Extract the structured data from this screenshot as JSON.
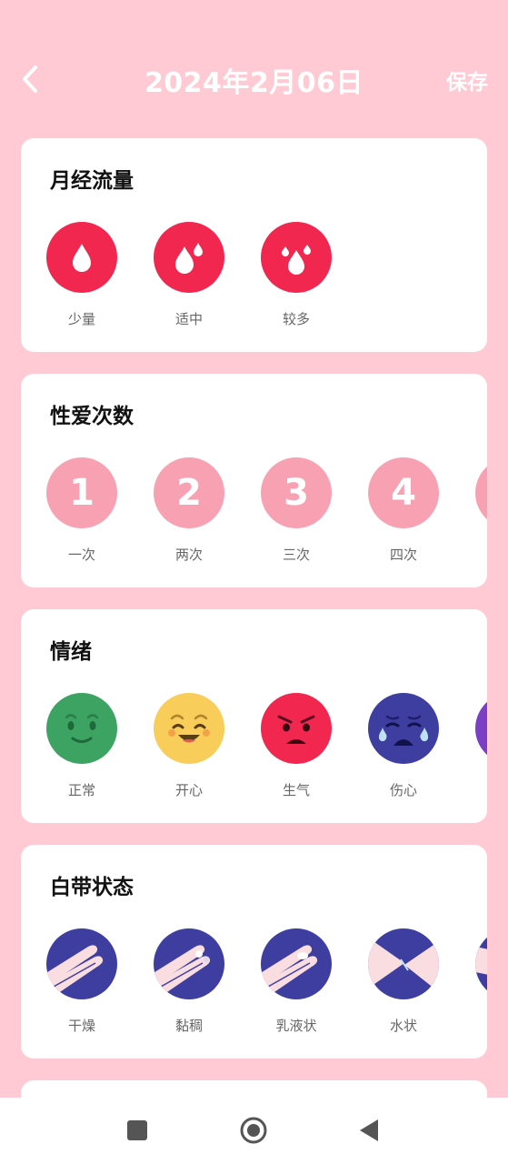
{
  "header": {
    "title": "2024年2月06日",
    "save_label": "保存"
  },
  "sections": [
    {
      "title": "月经流量",
      "options": [
        {
          "label": "少量",
          "icon": "single-drop-icon"
        },
        {
          "label": "适中",
          "icon": "two-drops-icon"
        },
        {
          "label": "较多",
          "icon": "many-drops-icon"
        }
      ]
    },
    {
      "title": "性爱次数",
      "options": [
        {
          "label": "一次",
          "value": "1"
        },
        {
          "label": "两次",
          "value": "2"
        },
        {
          "label": "三次",
          "value": "3"
        },
        {
          "label": "四次",
          "value": "4"
        }
      ]
    },
    {
      "title": "情绪",
      "options": [
        {
          "label": "正常",
          "icon": "neutral-face-icon"
        },
        {
          "label": "开心",
          "icon": "happy-face-icon"
        },
        {
          "label": "生气",
          "icon": "angry-face-icon"
        },
        {
          "label": "伤心",
          "icon": "sad-face-icon"
        }
      ]
    },
    {
      "title": "白带状态",
      "options": [
        {
          "label": "干燥",
          "icon": "dry-fingers-icon"
        },
        {
          "label": "黏稠",
          "icon": "sticky-fingers-icon"
        },
        {
          "label": "乳液状",
          "icon": "creamy-fingers-icon"
        },
        {
          "label": "水状",
          "icon": "watery-fingers-icon"
        }
      ]
    }
  ],
  "colors": {
    "background": "#FFCAD3",
    "flow_red": "#F2274F",
    "count_pink": "#F8A1B3",
    "mood_green": "#3DA363",
    "mood_yellow": "#F8CD5A",
    "mood_red": "#F2274F",
    "mood_blue": "#3E3EA1",
    "mood_purple": "#7B3FC6",
    "discharge_blue": "#3E3EA1"
  }
}
